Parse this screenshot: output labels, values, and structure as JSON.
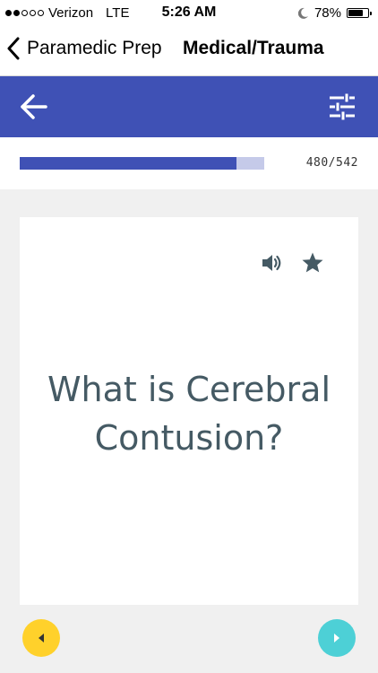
{
  "status_bar": {
    "carrier": "Verizon",
    "network": "LTE",
    "time": "5:26 AM",
    "battery": "78%",
    "battery_level": 0.78,
    "signal_bars": 2,
    "signal_total": 5
  },
  "nav": {
    "back_label": "Paramedic Prep",
    "title": "Medical/Trauma"
  },
  "toolbar": {
    "back_icon": "arrow-left-icon",
    "settings_icon": "sliders-icon",
    "color": "#3f51b5"
  },
  "progress": {
    "current": 480,
    "total": 542,
    "label": "480/542"
  },
  "card": {
    "question": "What is Cerebral Contusion?",
    "icons": [
      "speaker-icon",
      "star-icon"
    ],
    "text_color": "#455a64"
  },
  "controls": {
    "prev_color": "#ffd12b",
    "next_color": "#4dd0d6"
  }
}
